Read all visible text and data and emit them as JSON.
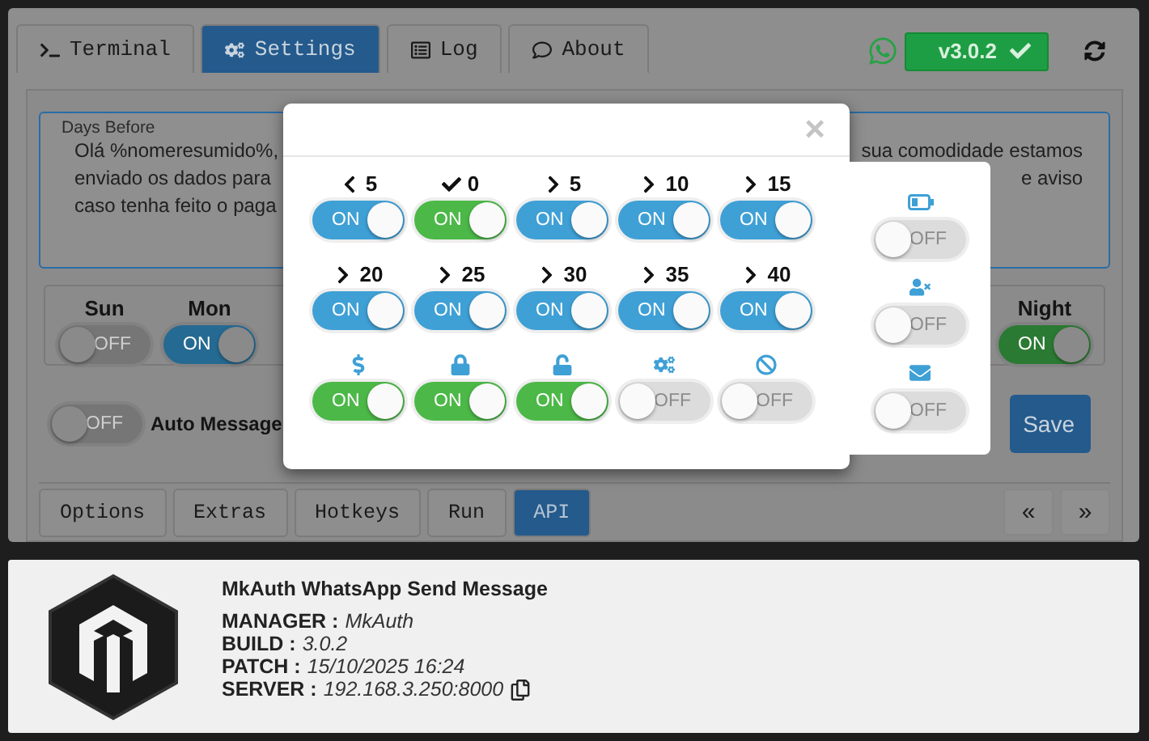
{
  "top_tabs": [
    {
      "label": "Terminal",
      "selected": false
    },
    {
      "label": "Settings",
      "selected": true
    },
    {
      "label": "Log",
      "selected": false
    },
    {
      "label": "About",
      "selected": false
    }
  ],
  "version_button": {
    "label": "v3.0.2"
  },
  "message_box": {
    "label": "Days Before",
    "lines": [
      {
        "left": "Olá %nomeresumido%,",
        "right": "sua comodidade estamos"
      },
      {
        "left": "enviado os dados para",
        "right": "e aviso"
      },
      {
        "left": "caso tenha feito o paga"
      }
    ]
  },
  "days": [
    {
      "label": "Sun",
      "on": false,
      "text": "OFF"
    },
    {
      "label": "Mon",
      "on": true,
      "text": "ON",
      "color": "#256a92"
    },
    {
      "label": "Night",
      "on": true,
      "text": "ON",
      "color": "#2b7a33"
    }
  ],
  "auto_message": {
    "label": "Auto Message",
    "on": false,
    "text": "OFF"
  },
  "save_button": {
    "label": "Save"
  },
  "bottom_tabs": [
    {
      "label": "Options",
      "selected": false
    },
    {
      "label": "Extras",
      "selected": false
    },
    {
      "label": "Hotkeys",
      "selected": false
    },
    {
      "label": "Run",
      "selected": false
    },
    {
      "label": "API",
      "selected": true
    }
  ],
  "pager": [
    "«",
    "»"
  ],
  "modal": {
    "close": "×",
    "rows": [
      {
        "items": [
          {
            "kind": "less",
            "label": "5",
            "on": true,
            "text": "ON",
            "color": "#3fa0d6"
          },
          {
            "kind": "exact",
            "label": "0",
            "on": true,
            "text": "ON",
            "color": "#4cb848"
          },
          {
            "kind": "more",
            "label": "5",
            "on": true,
            "text": "ON",
            "color": "#3fa0d6"
          },
          {
            "kind": "more",
            "label": "10",
            "on": true,
            "text": "ON",
            "color": "#3fa0d6"
          },
          {
            "kind": "more",
            "label": "15",
            "on": true,
            "text": "ON",
            "color": "#3fa0d6"
          }
        ]
      },
      {
        "items": [
          {
            "kind": "more",
            "label": "20",
            "on": true,
            "text": "ON",
            "color": "#3fa0d6"
          },
          {
            "kind": "more",
            "label": "25",
            "on": true,
            "text": "ON",
            "color": "#3fa0d6"
          },
          {
            "kind": "more",
            "label": "30",
            "on": true,
            "text": "ON",
            "color": "#3fa0d6"
          },
          {
            "kind": "more",
            "label": "35",
            "on": true,
            "text": "ON",
            "color": "#3fa0d6"
          },
          {
            "kind": "more",
            "label": "40",
            "on": true,
            "text": "ON",
            "color": "#3fa0d6"
          }
        ]
      },
      {
        "items": [
          {
            "kind": "payment",
            "on": true,
            "text": "ON",
            "color": "#4cb848"
          },
          {
            "kind": "locked",
            "on": true,
            "text": "ON",
            "color": "#4cb848"
          },
          {
            "kind": "unlocked",
            "on": true,
            "text": "ON",
            "color": "#4cb848"
          },
          {
            "kind": "settings",
            "on": false,
            "text": "OFF"
          },
          {
            "kind": "blocked",
            "on": false,
            "text": "OFF"
          }
        ]
      }
    ]
  },
  "side_panel": [
    {
      "kind": "battery",
      "on": false,
      "text": "OFF"
    },
    {
      "kind": "contact",
      "on": false,
      "text": "OFF"
    },
    {
      "kind": "mail",
      "on": false,
      "text": "OFF"
    }
  ],
  "about": {
    "title": "MkAuth WhatsApp Send Message",
    "fields": [
      {
        "label": "MANAGER :",
        "value": "MkAuth"
      },
      {
        "label": "BUILD :",
        "value": "3.0.2"
      },
      {
        "label": "PATCH :",
        "value": "15/10/2025 16:24"
      },
      {
        "label": "SERVER :",
        "value": "192.168.3.250:8000",
        "copy": true
      }
    ]
  }
}
